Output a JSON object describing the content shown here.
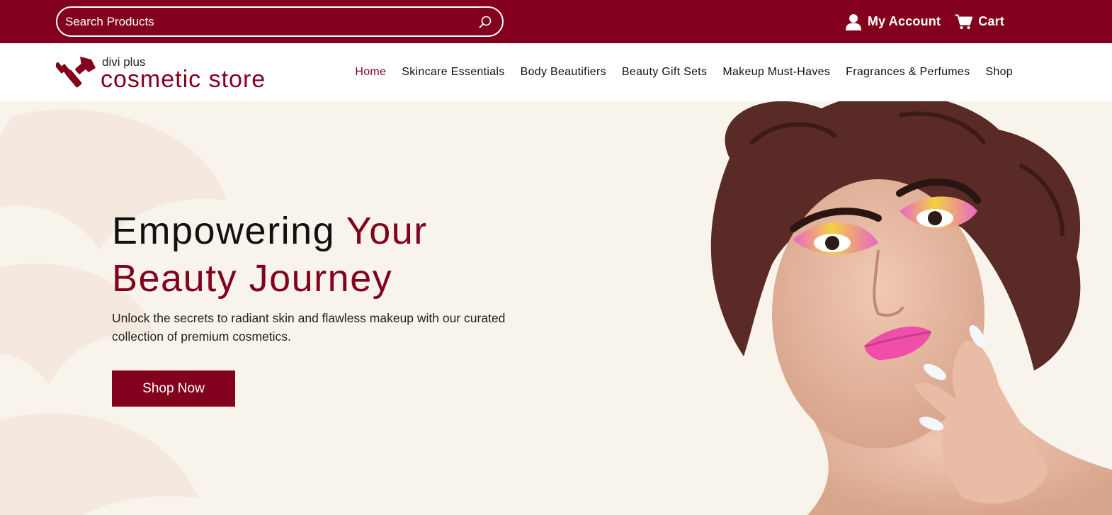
{
  "topbar": {
    "search_placeholder": "Search Products",
    "search_icon": "search-icon",
    "account_label": "My Account",
    "account_icon": "user-icon",
    "cart_label": "Cart",
    "cart_icon": "cart-icon"
  },
  "logo": {
    "subtitle": "divi plus",
    "title": "cosmetic store"
  },
  "nav": {
    "items": [
      {
        "label": "Home",
        "active": true
      },
      {
        "label": "Skincare Essentials"
      },
      {
        "label": "Body Beautifiers"
      },
      {
        "label": "Beauty Gift Sets"
      },
      {
        "label": "Makeup Must-Haves"
      },
      {
        "label": "Fragrances & Perfumes"
      },
      {
        "label": "Shop"
      }
    ]
  },
  "hero": {
    "title_part1": "Empowering ",
    "title_part2": "Your",
    "title_line2": "Beauty Journey",
    "description": "Unlock the secrets to radiant skin and flawless makeup with our curated collection of premium cosmetics.",
    "button_label": "Shop Now"
  },
  "colors": {
    "brand": "#82001e",
    "background": "#f8f4ec",
    "header_bg": "#ffffff"
  }
}
